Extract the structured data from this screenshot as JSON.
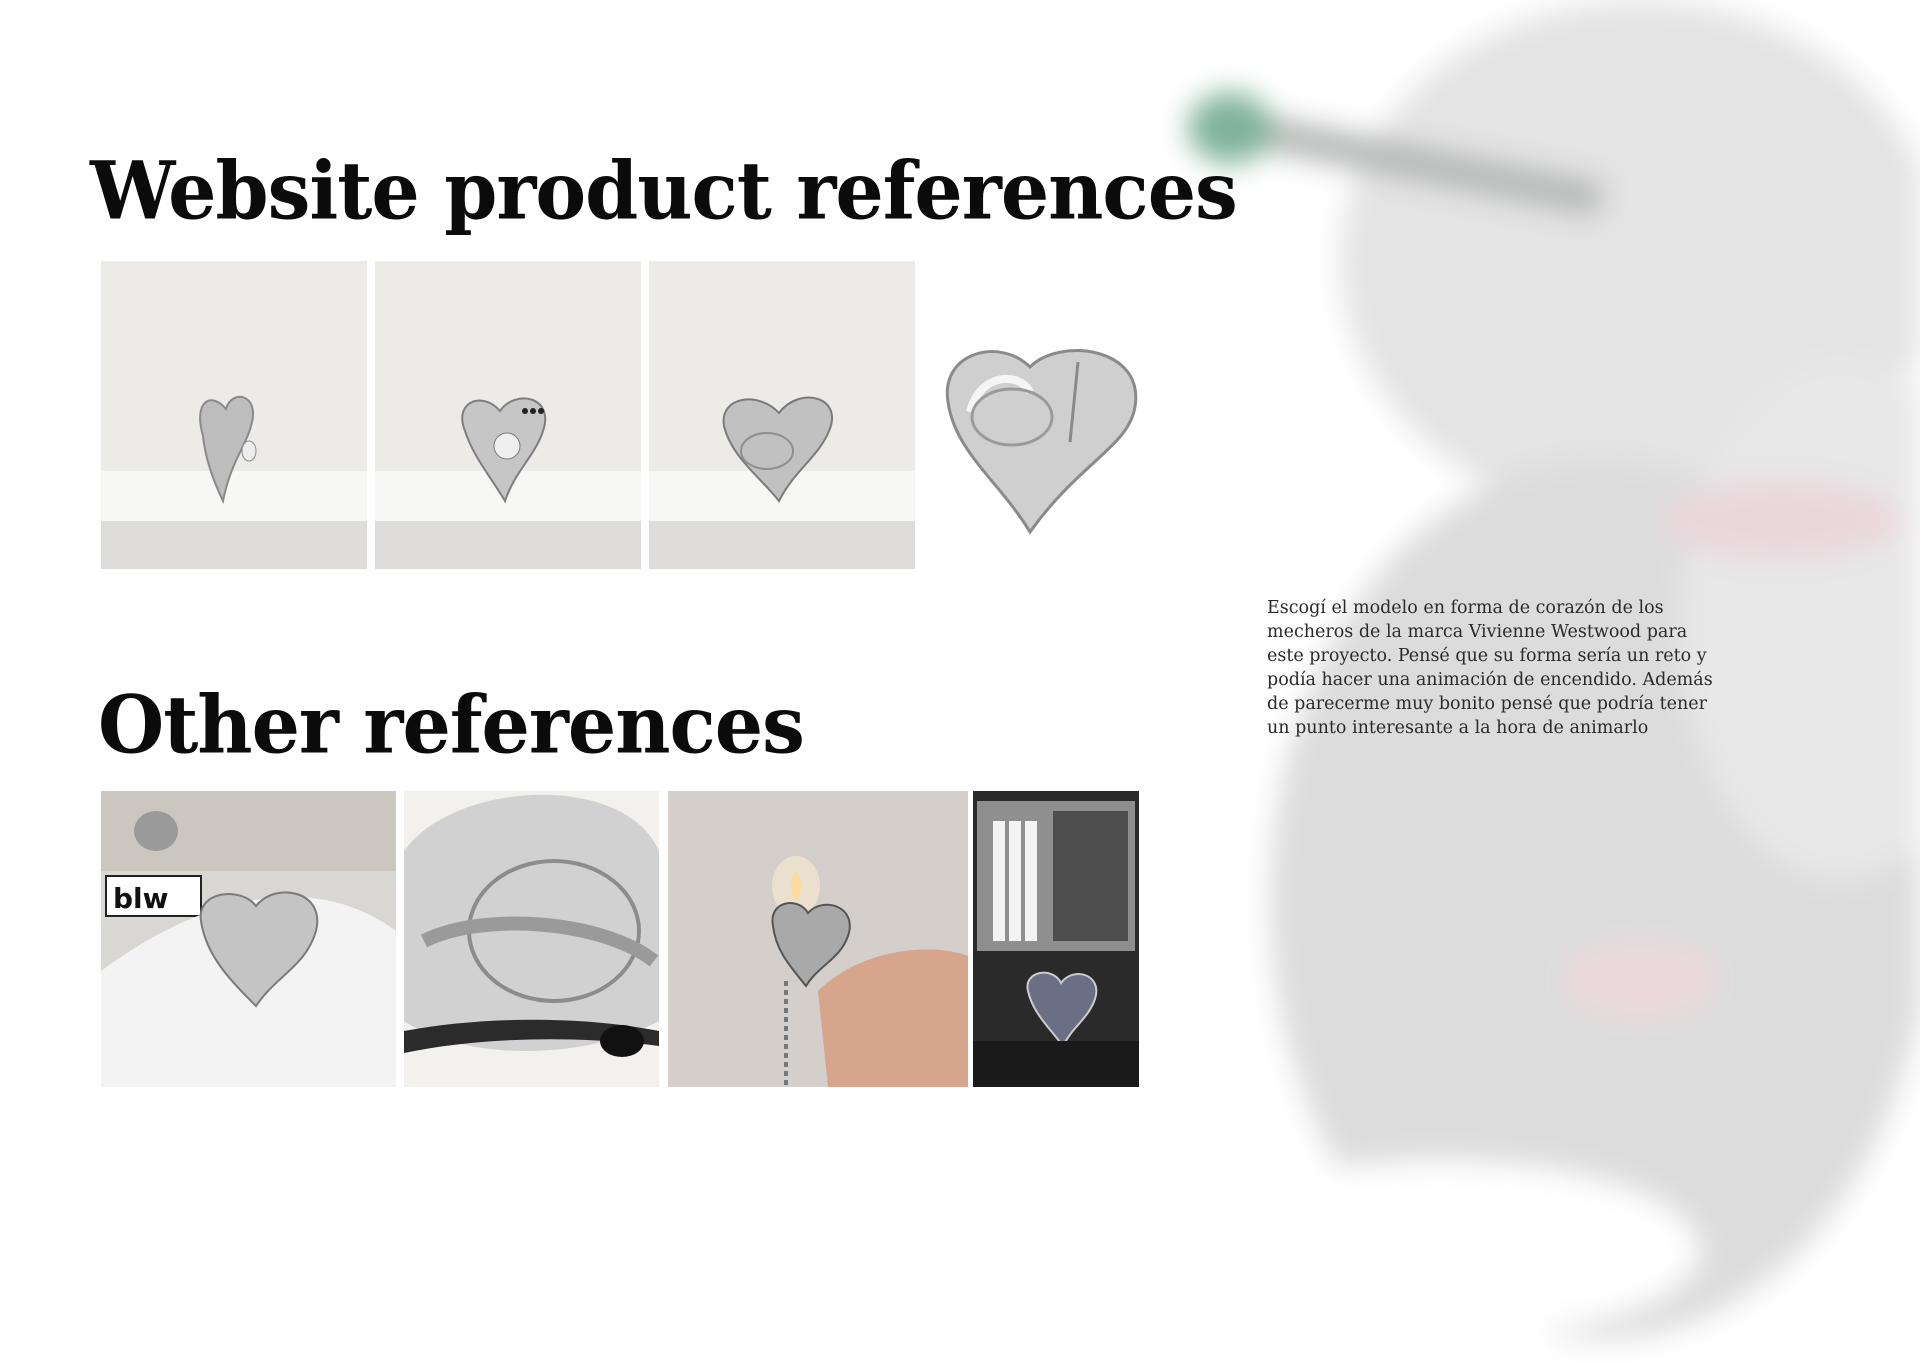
{
  "headings": {
    "website": "Website product references",
    "other": "Other references"
  },
  "description": "Escogí el modelo en forma de corazón de los mecheros de la marca Vivienne Westwood para este proyecto. Pensé que su forma sería un reto y podía hacer una animación de encendido. Además de parecerme muy bonito pensé que podría tener un punto interesante a la hora de animarlo",
  "images": {
    "website": [
      {
        "label": "heart-lighter-side-view"
      },
      {
        "label": "heart-lighter-front-view"
      },
      {
        "label": "heart-lighter-back-view"
      },
      {
        "label": "heart-lighter-cutout"
      }
    ],
    "other": [
      {
        "label": "lighter-in-gloved-hand",
        "overlay_text": "blw"
      },
      {
        "label": "lighter-orb-closeup"
      },
      {
        "label": "lit-lighter-in-hand"
      },
      {
        "label": "cigarette-case-and-lighter"
      }
    ]
  },
  "colors": {
    "heading": "#0b0b0b",
    "body_text": "#2a2a2a",
    "chrome": "#c9c9c9",
    "studio_bg": "#ecebe8"
  }
}
